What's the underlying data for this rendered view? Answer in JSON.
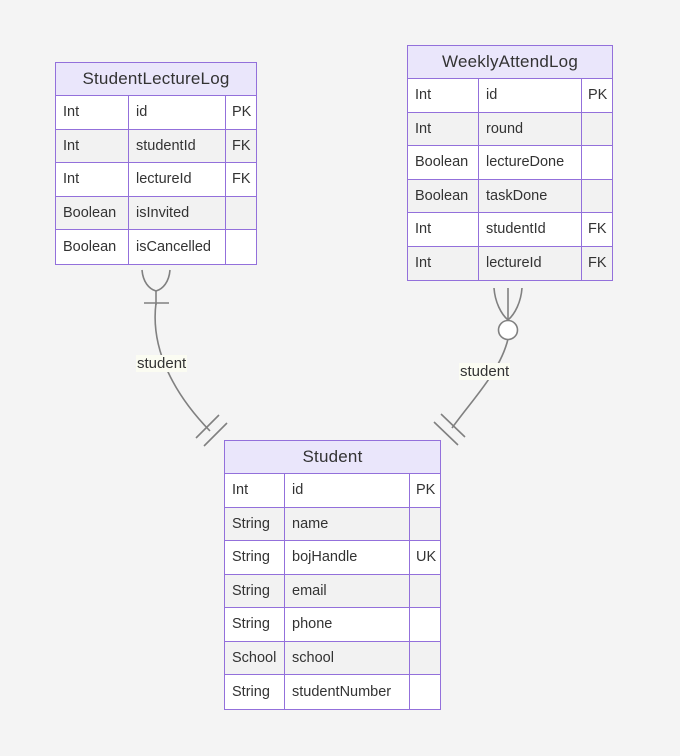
{
  "diagram": {
    "type": "entity-relationship-diagram",
    "background_color": "#f4f4f4",
    "entity_border_color": "#9370db",
    "entity_header_color": "#eae6fb",
    "link_color": "#808080",
    "entities": [
      {
        "id": "studentlecturelog",
        "name": "StudentLectureLog",
        "attributes": [
          {
            "type": "Int",
            "name": "id",
            "key": "PK"
          },
          {
            "type": "Int",
            "name": "studentId",
            "key": "FK"
          },
          {
            "type": "Int",
            "name": "lectureId",
            "key": "FK"
          },
          {
            "type": "Boolean",
            "name": "isInvited",
            "key": ""
          },
          {
            "type": "Boolean",
            "name": "isCancelled",
            "key": ""
          }
        ]
      },
      {
        "id": "weeklyattendlog",
        "name": "WeeklyAttendLog",
        "attributes": [
          {
            "type": "Int",
            "name": "id",
            "key": "PK"
          },
          {
            "type": "Int",
            "name": "round",
            "key": ""
          },
          {
            "type": "Boolean",
            "name": "lectureDone",
            "key": ""
          },
          {
            "type": "Boolean",
            "name": "taskDone",
            "key": ""
          },
          {
            "type": "Int",
            "name": "studentId",
            "key": "FK"
          },
          {
            "type": "Int",
            "name": "lectureId",
            "key": "FK"
          }
        ]
      },
      {
        "id": "student",
        "name": "Student",
        "attributes": [
          {
            "type": "Int",
            "name": "id",
            "key": "PK"
          },
          {
            "type": "String",
            "name": "name",
            "key": ""
          },
          {
            "type": "String",
            "name": "bojHandle",
            "key": "UK"
          },
          {
            "type": "String",
            "name": "email",
            "key": ""
          },
          {
            "type": "String",
            "name": "phone",
            "key": ""
          },
          {
            "type": "School",
            "name": "school",
            "key": ""
          },
          {
            "type": "String",
            "name": "studentNumber",
            "key": ""
          }
        ]
      }
    ],
    "relationships": [
      {
        "id": "left",
        "label": "student",
        "from_entity": "Student",
        "to_entity": "StudentLectureLog",
        "from_cardinality": "exactly-one",
        "to_cardinality": "one-or-many"
      },
      {
        "id": "right",
        "label": "student",
        "from_entity": "Student",
        "to_entity": "WeeklyAttendLog",
        "from_cardinality": "exactly-one",
        "to_cardinality": "zero-or-many"
      }
    ]
  }
}
